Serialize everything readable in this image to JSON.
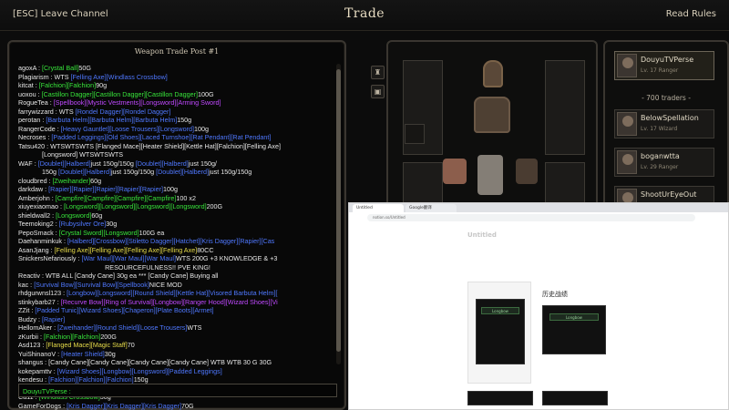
{
  "topbar": {
    "leave": "[ESC] Leave Channel",
    "title": "Trade",
    "rules": "Read Rules"
  },
  "chat": {
    "title": "Weapon Trade Post #1",
    "input_label": "DouyuTVPerse :",
    "lines": [
      {
        "parts": [
          {
            "t": "agoxA : ",
            "c": "w"
          },
          {
            "t": "[Crystal Ball]",
            "c": "g"
          },
          {
            "t": "50G",
            "c": "w"
          }
        ]
      },
      {
        "parts": [
          {
            "t": "Plagiarism : WTS ",
            "c": "w"
          },
          {
            "t": "[Felling Axe]",
            "c": "b"
          },
          {
            "t": "[Windlass Crossbow]",
            "c": "b"
          }
        ]
      },
      {
        "parts": [
          {
            "t": "kitcat : ",
            "c": "w"
          },
          {
            "t": "[Falchion]",
            "c": "g"
          },
          {
            "t": "[Falchion]",
            "c": "g"
          },
          {
            "t": "90g",
            "c": "w"
          }
        ]
      },
      {
        "parts": [
          {
            "t": "uoxou : ",
            "c": "w"
          },
          {
            "t": "[Castillon Dagger]",
            "c": "g"
          },
          {
            "t": "[Castillon Dagger]",
            "c": "g"
          },
          {
            "t": "[Castillon Dagger]",
            "c": "g"
          },
          {
            "t": "100G",
            "c": "w"
          }
        ]
      },
      {
        "parts": [
          {
            "t": "RogueTea : ",
            "c": "w"
          },
          {
            "t": "[Spellbook]",
            "c": "p"
          },
          {
            "t": "[Mystic Vestments]",
            "c": "p"
          },
          {
            "t": "[Longsword]",
            "c": "p"
          },
          {
            "t": "[Arming Sword]",
            "c": "p"
          }
        ]
      },
      {
        "parts": [
          {
            "t": "farrywizzard : WTS ",
            "c": "w"
          },
          {
            "t": "[Rondel Dagger]",
            "c": "b"
          },
          {
            "t": "[Rondel Dagger]",
            "c": "b"
          }
        ]
      },
      {
        "parts": [
          {
            "t": "perotan : ",
            "c": "w"
          },
          {
            "t": "[Barbuta Helm]",
            "c": "b"
          },
          {
            "t": "[Barbuta Helm]",
            "c": "b"
          },
          {
            "t": "[Barbuta Helm]",
            "c": "b"
          },
          {
            "t": "150g",
            "c": "w"
          }
        ]
      },
      {
        "parts": [
          {
            "t": "RangerCode : ",
            "c": "w"
          },
          {
            "t": "[Heavy Gauntlet]",
            "c": "b"
          },
          {
            "t": "[Loose Trousers]",
            "c": "b"
          },
          {
            "t": "[Longsword]",
            "c": "b"
          },
          {
            "t": "100g",
            "c": "w"
          }
        ]
      },
      {
        "parts": [
          {
            "t": "Necroses : ",
            "c": "w"
          },
          {
            "t": "[Padded Leggings]",
            "c": "b"
          },
          {
            "t": "[Old Shoes]",
            "c": "b"
          },
          {
            "t": "[Laced Turnshoe]",
            "c": "b"
          },
          {
            "t": "[Rat Pendant]",
            "c": "b"
          },
          {
            "t": "[Rat Pendant]",
            "c": "b"
          }
        ]
      },
      {
        "parts": [
          {
            "t": "Tatsu420 : WTSWTSWTS [Flanged Mace][Heater Shield][Kettle Hat][Falchion][Felling Axe]",
            "c": "w"
          }
        ]
      },
      {
        "indent": true,
        "parts": [
          {
            "t": "[Longsword] WTSWTSWTS",
            "c": "w"
          }
        ]
      },
      {
        "parts": [
          {
            "t": "WAF : ",
            "c": "w"
          },
          {
            "t": "[Doublet]",
            "c": "b"
          },
          {
            "t": "[Halberd]",
            "c": "b"
          },
          {
            "t": "just 150g/150g ",
            "c": "w"
          },
          {
            "t": "[Doublet]",
            "c": "b"
          },
          {
            "t": "[Halberd]",
            "c": "b"
          },
          {
            "t": "just 150g/",
            "c": "w"
          }
        ]
      },
      {
        "indent": true,
        "parts": [
          {
            "t": "150g ",
            "c": "w"
          },
          {
            "t": "[Doublet]",
            "c": "b"
          },
          {
            "t": "[Halberd]",
            "c": "b"
          },
          {
            "t": "just 150g/150g ",
            "c": "w"
          },
          {
            "t": "[Doublet]",
            "c": "b"
          },
          {
            "t": "[Halberd]",
            "c": "b"
          },
          {
            "t": "just 150g/150g",
            "c": "w"
          }
        ]
      },
      {
        "parts": [
          {
            "t": "cloudbred : ",
            "c": "w"
          },
          {
            "t": "[Zweihander]",
            "c": "g"
          },
          {
            "t": "60g",
            "c": "w"
          }
        ]
      },
      {
        "parts": [
          {
            "t": "darkdaw : ",
            "c": "w"
          },
          {
            "t": "[Rapier]",
            "c": "b"
          },
          {
            "t": "[Rapier]",
            "c": "b"
          },
          {
            "t": "[Rapier]",
            "c": "b"
          },
          {
            "t": "[Rapier]",
            "c": "b"
          },
          {
            "t": "[Rapier]",
            "c": "b"
          },
          {
            "t": "100g",
            "c": "w"
          }
        ]
      },
      {
        "parts": [
          {
            "t": "Amberjohn : ",
            "c": "w"
          },
          {
            "t": "[Campfire]",
            "c": "g"
          },
          {
            "t": "[Campfire]",
            "c": "g"
          },
          {
            "t": "[Campfire]",
            "c": "g"
          },
          {
            "t": "[Campfire]",
            "c": "g"
          },
          {
            "t": "100 x2",
            "c": "w"
          }
        ]
      },
      {
        "parts": [
          {
            "t": "xiuyexiaomao : ",
            "c": "w"
          },
          {
            "t": "[Longsword]",
            "c": "g"
          },
          {
            "t": "[Longsword]",
            "c": "g"
          },
          {
            "t": "[Longsword]",
            "c": "g"
          },
          {
            "t": "[Longsword]",
            "c": "g"
          },
          {
            "t": "200G",
            "c": "w"
          }
        ]
      },
      {
        "parts": [
          {
            "t": "shieldwall2 : ",
            "c": "w"
          },
          {
            "t": "[Longsword]",
            "c": "g"
          },
          {
            "t": "60g",
            "c": "w"
          }
        ]
      },
      {
        "parts": [
          {
            "t": "Teemoking2 : ",
            "c": "w"
          },
          {
            "t": "[Rubysilver Ore]",
            "c": "b"
          },
          {
            "t": "30g",
            "c": "w"
          }
        ]
      },
      {
        "parts": [
          {
            "t": "PepoSmack : ",
            "c": "w"
          },
          {
            "t": "[Crystal Sword]",
            "c": "g"
          },
          {
            "t": "[Longsword]",
            "c": "g"
          },
          {
            "t": "100G ea",
            "c": "w"
          }
        ]
      },
      {
        "parts": [
          {
            "t": "Daehanminkuk : ",
            "c": "w"
          },
          {
            "t": "[Halberd]",
            "c": "b"
          },
          {
            "t": "[Crossbow]",
            "c": "b"
          },
          {
            "t": "[Stiletto Dagger]",
            "c": "b"
          },
          {
            "t": "[Hatchet]",
            "c": "b"
          },
          {
            "t": "[Kris Dagger]",
            "c": "b"
          },
          {
            "t": "[Rapier]",
            "c": "b"
          },
          {
            "t": "[Cas",
            "c": "b"
          }
        ]
      },
      {
        "parts": [
          {
            "t": "AsanJjang : ",
            "c": "w"
          },
          {
            "t": "[Felling Axe]",
            "c": "y"
          },
          {
            "t": "[Felling Axe]",
            "c": "y"
          },
          {
            "t": "[Felling Axe]",
            "c": "y"
          },
          {
            "t": "[Felling Axe]",
            "c": "y"
          },
          {
            "t": "80CC",
            "c": "w"
          }
        ]
      },
      {
        "parts": [
          {
            "t": "SnickersNefariously : ",
            "c": "w"
          },
          {
            "t": "[War Maul]",
            "c": "b"
          },
          {
            "t": "[War Maul]",
            "c": "b"
          },
          {
            "t": "[War Maul]",
            "c": "b"
          },
          {
            "t": "WTS 200G +3 KNOWLEDGE & +3",
            "c": "w"
          }
        ]
      },
      {
        "center": true,
        "parts": [
          {
            "t": "RESOURCEFULNESS!! PVE KING!",
            "c": "w"
          }
        ]
      },
      {
        "parts": [
          {
            "t": "Reactiv : WTB ALL [Candy Cane] 30g ea *** [Candy Cane] Buying all",
            "c": "w"
          }
        ]
      },
      {
        "parts": [
          {
            "t": "kac : ",
            "c": "w"
          },
          {
            "t": "[Survival Bow]",
            "c": "b"
          },
          {
            "t": "[Survival Bow]",
            "c": "b"
          },
          {
            "t": "[Spellbook]",
            "c": "b"
          },
          {
            "t": "NICE MOD",
            "c": "w"
          }
        ]
      },
      {
        "parts": [
          {
            "t": "rhdgurwnsl123 : ",
            "c": "w"
          },
          {
            "t": "[Longbow]",
            "c": "b"
          },
          {
            "t": "[Longsword]",
            "c": "b"
          },
          {
            "t": "[Round Shield]",
            "c": "b"
          },
          {
            "t": "[Kettle Hat]",
            "c": "b"
          },
          {
            "t": "[Visored Barbuta Helm]",
            "c": "b"
          },
          {
            "t": "[",
            "c": "b"
          }
        ]
      },
      {
        "parts": [
          {
            "t": "stinkybarb27 : ",
            "c": "w"
          },
          {
            "t": "[Recurve Bow]",
            "c": "p"
          },
          {
            "t": "[Ring of Survival]",
            "c": "p"
          },
          {
            "t": "[Longbow]",
            "c": "p"
          },
          {
            "t": "[Ranger Hood]",
            "c": "p"
          },
          {
            "t": "[Wizard Shoes]",
            "c": "p"
          },
          {
            "t": "[Vi",
            "c": "p"
          }
        ]
      },
      {
        "parts": [
          {
            "t": "ZZit : ",
            "c": "w"
          },
          {
            "t": "[Padded Tunic]",
            "c": "b"
          },
          {
            "t": "[Wizard Shoes]",
            "c": "b"
          },
          {
            "t": "[Chaperon]",
            "c": "b"
          },
          {
            "t": "[Plate Boots]",
            "c": "b"
          },
          {
            "t": "[Armet]",
            "c": "b"
          }
        ]
      },
      {
        "parts": [
          {
            "t": "Budzy : ",
            "c": "w"
          },
          {
            "t": "[Rapier]",
            "c": "b"
          }
        ]
      },
      {
        "parts": [
          {
            "t": "HellomAker : ",
            "c": "w"
          },
          {
            "t": "[Zweihander]",
            "c": "b"
          },
          {
            "t": "[Round Shield]",
            "c": "b"
          },
          {
            "t": "[Loose Trousers]",
            "c": "b"
          },
          {
            "t": "WTS",
            "c": "w"
          }
        ]
      },
      {
        "parts": [
          {
            "t": "zKurbii : ",
            "c": "w"
          },
          {
            "t": "[Falchion]",
            "c": "g"
          },
          {
            "t": "[Falchion]",
            "c": "g"
          },
          {
            "t": "200G",
            "c": "w"
          }
        ]
      },
      {
        "parts": [
          {
            "t": "Asd123 : ",
            "c": "w"
          },
          {
            "t": "[Flanged Mace]",
            "c": "y"
          },
          {
            "t": "[Magic Staff]",
            "c": "y"
          },
          {
            "t": "70",
            "c": "w"
          }
        ]
      },
      {
        "parts": [
          {
            "t": "YuiShinanoV : ",
            "c": "w"
          },
          {
            "t": "[Heater Shield]",
            "c": "b"
          },
          {
            "t": "30g",
            "c": "w"
          }
        ]
      },
      {
        "parts": [
          {
            "t": "shangus : [Candy Cane][Candy Cane][Candy Cane][Candy Cane] WTB WTB 30 G 30G",
            "c": "w"
          }
        ]
      },
      {
        "parts": [
          {
            "t": "kokepamttv : ",
            "c": "w"
          },
          {
            "t": "[Wizard Shoes]",
            "c": "b"
          },
          {
            "t": "[Longbow]",
            "c": "b"
          },
          {
            "t": "[Longsword]",
            "c": "b"
          },
          {
            "t": "[Padded Leggings]",
            "c": "b"
          }
        ]
      },
      {
        "parts": [
          {
            "t": "kendesu : ",
            "c": "w"
          },
          {
            "t": "[Falchion]",
            "c": "b"
          },
          {
            "t": "[Falchion]",
            "c": "b"
          },
          {
            "t": "[Falchion]",
            "c": "b"
          },
          {
            "t": "150g",
            "c": "w"
          }
        ]
      },
      {
        "parts": [
          {
            "t": "Shim4risu : ",
            "c": "w"
          },
          {
            "t": "[Wizard Shoes]",
            "c": "b"
          },
          {
            "t": "110g !!!",
            "c": "w"
          }
        ]
      },
      {
        "parts": [
          {
            "t": "Ca11 : ",
            "c": "w"
          },
          {
            "t": "[Windlass Crossbow]",
            "c": "g"
          },
          {
            "t": "30g",
            "c": "w"
          }
        ]
      },
      {
        "parts": [
          {
            "t": "GameForDogs : ",
            "c": "w"
          },
          {
            "t": "[Kris Dagger]",
            "c": "b"
          },
          {
            "t": "[Kris Dagger]",
            "c": "b"
          },
          {
            "t": "[Kris Dagger]",
            "c": "b"
          },
          {
            "t": "70G",
            "c": "w"
          }
        ]
      }
    ]
  },
  "equipment": {
    "side_buttons": [
      {
        "icon": "helmet-icon",
        "glyph": "♜"
      },
      {
        "icon": "inventory-icon",
        "glyph": "▣"
      }
    ]
  },
  "traders": {
    "self": {
      "name": "DouyuTVPerse",
      "sub": "Lv. 17 Ranger"
    },
    "count_label": "- 700 traders -",
    "list": [
      {
        "name": "BelowSpellation",
        "sub": "Lv. 17 Wizard"
      },
      {
        "name": "boganwtta",
        "sub": "Lv. 29 Ranger"
      },
      {
        "name": "ShootUrEyeOut",
        "sub": ""
      }
    ]
  },
  "browser": {
    "tabs": [
      "Untitled",
      "Google翻译"
    ],
    "address": "notion.so/Untitled",
    "page_title": "Untitled",
    "heading_cn": "历史战绩",
    "card_label": "Longbow",
    "card_label2": "Longbow"
  },
  "colors": {
    "green": "#38e63b",
    "blue": "#4f78ff",
    "purple": "#c049ff",
    "yellow": "#e8dd4a"
  }
}
